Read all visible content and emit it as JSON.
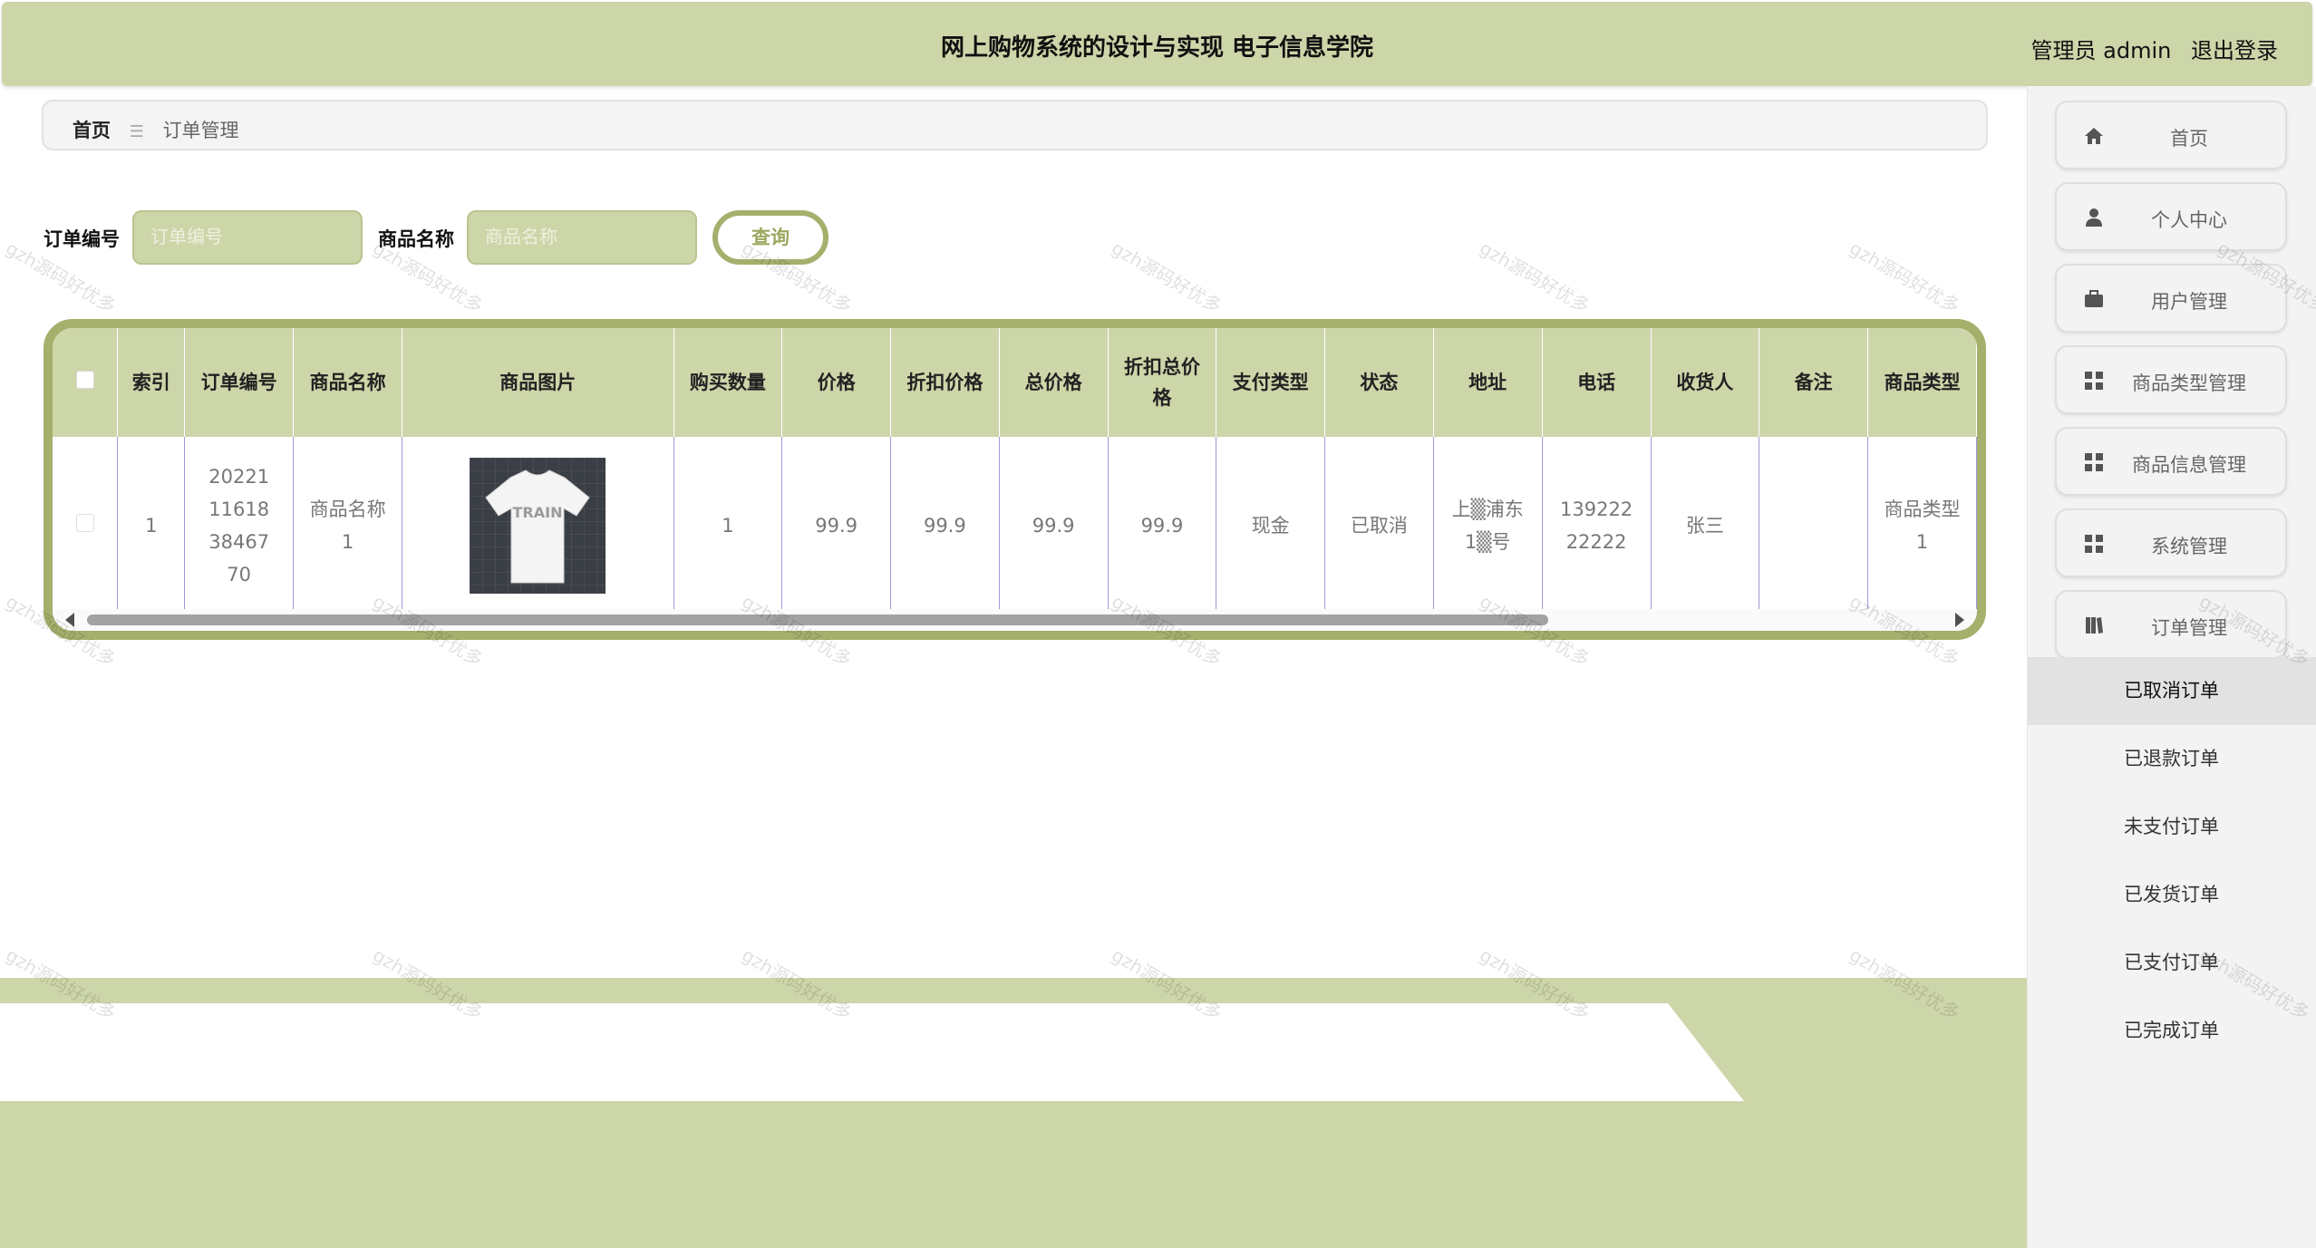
{
  "header": {
    "title": "网上购物系统的设计与实现 电子信息学院",
    "admin": "管理员 admin",
    "logout": "退出登录"
  },
  "breadcrumb": {
    "home": "首页",
    "separator": "☰",
    "current": "订单管理"
  },
  "search": {
    "order_no_label": "订单编号",
    "order_no_placeholder": "订单编号",
    "product_label": "商品名称",
    "product_placeholder": "商品名称",
    "query_button": "查询"
  },
  "table": {
    "columns": [
      "",
      "索引",
      "订单编号",
      "商品名称",
      "商品图片",
      "购买数量",
      "价格",
      "折扣价格",
      "总价格",
      "折扣总价格",
      "支付类型",
      "状态",
      "地址",
      "电话",
      "收货人",
      "备注",
      "商品类型"
    ],
    "rows": [
      {
        "index": "1",
        "order_no": "20221116183846770",
        "product_name": "商品名称1",
        "image_icon": "t-shirt-product-image",
        "quantity": "1",
        "price": "99.9",
        "discount_price": "99.9",
        "total_price": "99.9",
        "discount_total": "99.9",
        "pay_type": "现金",
        "status": "已取消",
        "address": "上▒浦东1▒号",
        "phone": "13922222222",
        "receiver": "张三",
        "remark": "",
        "product_type": "商品类型1"
      }
    ]
  },
  "sidebar": {
    "items": [
      {
        "label": "首页",
        "icon": "home-icon"
      },
      {
        "label": "个人中心",
        "icon": "user-icon"
      },
      {
        "label": "用户管理",
        "icon": "briefcase-icon"
      },
      {
        "label": "商品类型管理",
        "icon": "grid-icon"
      },
      {
        "label": "商品信息管理",
        "icon": "grid-icon"
      },
      {
        "label": "系统管理",
        "icon": "grid-icon"
      },
      {
        "label": "订单管理",
        "icon": "book-icon"
      }
    ],
    "submenu": [
      {
        "label": "已取消订单",
        "active": true
      },
      {
        "label": "已退款订单",
        "active": false
      },
      {
        "label": "未支付订单",
        "active": false
      },
      {
        "label": "已发货订单",
        "active": false
      },
      {
        "label": "已支付订单",
        "active": false
      },
      {
        "label": "已完成订单",
        "active": false
      }
    ]
  },
  "watermark": "gzh源码好优多",
  "colors": {
    "accent": "#cdd6a9",
    "accent_dark": "#a4b06c",
    "sidebar_bg": "#f3f3f3"
  }
}
